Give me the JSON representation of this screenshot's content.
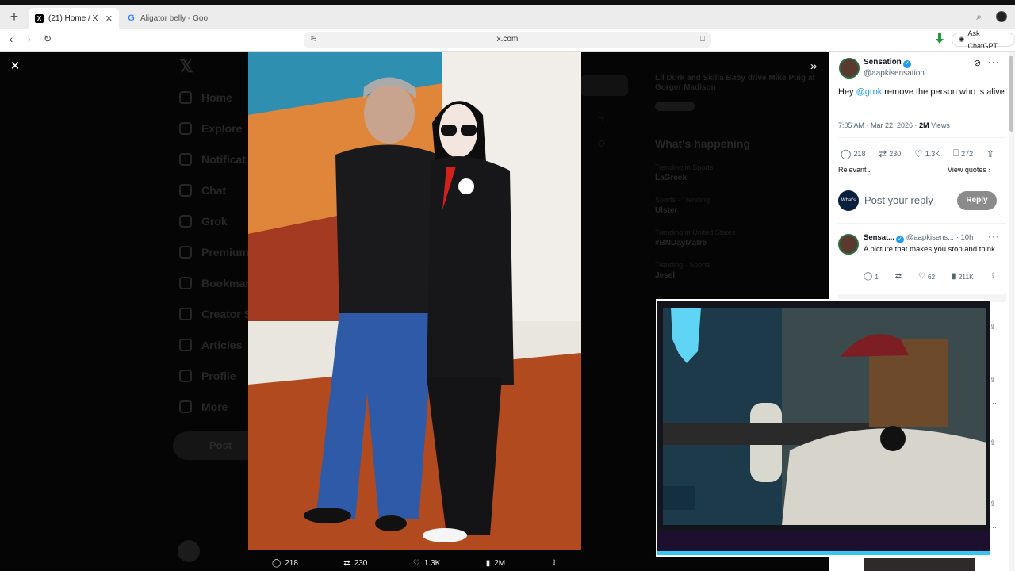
{
  "browser": {
    "tabs": [
      {
        "title": "(21) Home / X",
        "favicon": "x-logo",
        "active": true
      },
      {
        "title": "Aligator belly - Goog",
        "favicon": "google-logo",
        "active": false
      }
    ],
    "url": "x.com",
    "ask_chatgpt": "Ask ChatGPT"
  },
  "sidebar": {
    "items": [
      {
        "label": "Home",
        "icon": "home-icon"
      },
      {
        "label": "Explore",
        "icon": "search-icon"
      },
      {
        "label": "Notificat",
        "icon": "bell-icon"
      },
      {
        "label": "Chat",
        "icon": "chat-icon"
      },
      {
        "label": "Grok",
        "icon": "grok-icon"
      },
      {
        "label": "Premium",
        "icon": "x-icon"
      },
      {
        "label": "Bookmar",
        "icon": "bookmark-icon"
      },
      {
        "label": "Creator S",
        "icon": "creator-icon"
      },
      {
        "label": "Articles",
        "icon": "article-icon"
      },
      {
        "label": "Profile",
        "icon": "profile-icon"
      },
      {
        "label": "More",
        "icon": "more-icon"
      }
    ],
    "post_label": "Post"
  },
  "right_sidebar": {
    "live_text": "Lil Durk and Skilla Baby drive Mike Puig at Gorger Madison",
    "whats_happening": "What's happening",
    "trends": [
      {
        "context": "Trending in Sports",
        "title": "LaGreek"
      },
      {
        "context": "Sports · Trending",
        "title": "Ulster"
      },
      {
        "context": "Trending in United States",
        "title": "#BNDayMatre"
      },
      {
        "context": "Trending · Sports",
        "title": "Jesel"
      }
    ]
  },
  "viewer": {
    "stats": {
      "replies": "218",
      "reposts": "230",
      "likes": "1.3K",
      "views": "2M"
    }
  },
  "tweet": {
    "author_name": "Sensation",
    "author_handle": "@aapkisensation",
    "text_before": "Hey ",
    "mention": "@grok",
    "text_after": " remove the person who is alive",
    "time": "7:05 AM · Mar 22, 2026 · ",
    "views_count": "2M",
    "views_label": " Views",
    "replies": "218",
    "reposts": "230",
    "likes": "1.3K",
    "bookmarks": "272",
    "sort_label": "Relevant",
    "view_quotes": "View quotes",
    "reply_placeholder": "Post your reply",
    "reply_button": "Reply",
    "reply_avatar_text": "What's Next"
  },
  "reply": {
    "name": "Sensat...",
    "handle": "@aapkisens...",
    "age": "· 10h",
    "text": "A picture that makes you stop and think",
    "replies": "1",
    "likes": "62",
    "views": "211K"
  },
  "colors": {
    "accent": "#1d9bf0",
    "cam_border": "#35c6f4"
  }
}
